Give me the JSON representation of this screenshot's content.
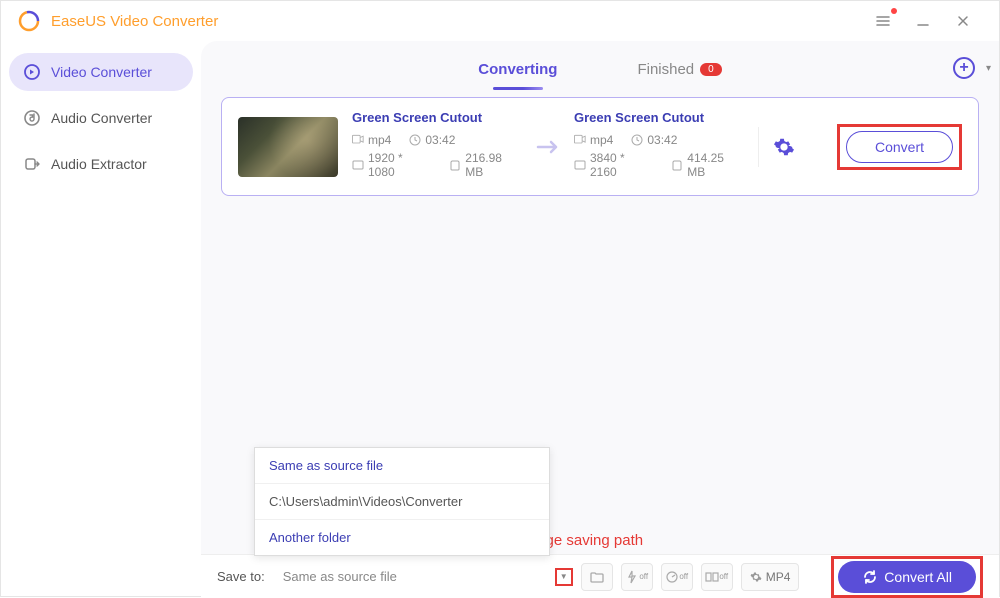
{
  "app_title": "EaseUS Video Converter",
  "sidebar": {
    "items": [
      {
        "label": "Video Converter"
      },
      {
        "label": "Audio Converter"
      },
      {
        "label": "Audio Extractor"
      }
    ]
  },
  "tabs": {
    "converting": "Converting",
    "finished": "Finished",
    "finished_badge": "0"
  },
  "item": {
    "source": {
      "title": "Green Screen Cutout",
      "format": "mp4",
      "duration": "03:42",
      "resolution": "1920 * 1080",
      "size": "216.98 MB"
    },
    "target": {
      "title": "Green Screen Cutout",
      "format": "mp4",
      "duration": "03:42",
      "resolution": "3840 * 2160",
      "size": "414.25 MB"
    },
    "convert_label": "Convert"
  },
  "dropdown": {
    "same": "Same as source file",
    "path": "C:\\Users\\admin\\Videos\\Converter",
    "another": "Another folder"
  },
  "annotation": "change saving path",
  "bottom": {
    "save_label": "Save to:",
    "save_value": "Same as source file",
    "format_label": "MP4",
    "convert_all": "Convert All"
  }
}
